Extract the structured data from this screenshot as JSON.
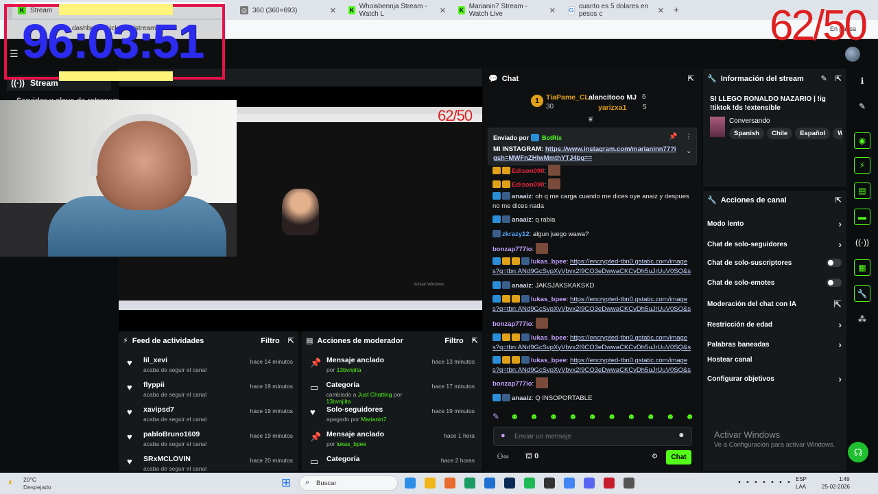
{
  "browser": {
    "tabs": [
      {
        "title": "Stream",
        "fav": "kick"
      },
      {
        "title": "360 (360×693)",
        "fav": "globe"
      },
      {
        "title": "Whoisbennja Stream - Watch L",
        "fav": "kick"
      },
      {
        "title": "Marianin7 Stream - Watch Live",
        "fav": "kick"
      },
      {
        "title": "cuanto es 5 dolares en pesos c",
        "fav": "google"
      }
    ],
    "new_tab": "+",
    "url": "dashboard.kick.com/stream",
    "profile_status": "En pausa"
  },
  "overlay": {
    "timer": "96:03:51",
    "counter": "62/50"
  },
  "nav": {
    "stream_label": "Stream",
    "sub_label": "Servidor y clave de retransm"
  },
  "preview": {
    "title": "Servidor y clave de retransm",
    "mini_counter": "62/50",
    "activate": "Activar Windows"
  },
  "feed": {
    "title": "Feed de actividades",
    "filter": "Filtro",
    "items": [
      {
        "name": "lil_xevi",
        "sub": "acaba de seguir el canal",
        "time": "hace 14 minutos"
      },
      {
        "name": "flyppii",
        "sub": "acaba de seguir el canal",
        "time": "hace 19 minutos"
      },
      {
        "name": "xavipsd7",
        "sub": "acaba de seguir el canal",
        "time": "hace 19 minutos"
      },
      {
        "name": "pabloBruno1609",
        "sub": "acaba de seguir el canal",
        "time": "hace 19 minutos"
      },
      {
        "name": "SRxMCLOVIN",
        "sub": "acaba de seguir el canal",
        "time": "hace 20 minutos"
      }
    ]
  },
  "modactions": {
    "title": "Acciones de moderador",
    "filter": "Filtro",
    "items": [
      {
        "name": "Mensaje anclado",
        "pre": "por ",
        "who": "13bvnjiita",
        "mid": "",
        "target": "",
        "time": "hace 13 minutos"
      },
      {
        "name": "Categoría",
        "pre": "cambiado a ",
        "who": "Just Chatting",
        "mid": " por ",
        "target": "13bvnjiita",
        "time": "hace 17 minutos"
      },
      {
        "name": "Solo-seguidores",
        "pre": "apagado por ",
        "who": "Marianin7",
        "mid": "",
        "target": "",
        "time": "hace 19 minutos"
      },
      {
        "name": "Mensaje anclado",
        "pre": "por ",
        "who": "lukas_bpee",
        "mid": "",
        "target": "",
        "time": "hace 1 hora"
      },
      {
        "name": "Categoría",
        "pre": "",
        "who": "",
        "mid": "",
        "target": "",
        "time": "hace 2 horas"
      }
    ]
  },
  "chat": {
    "title": "Chat",
    "leader1": {
      "rank": "1",
      "name": "TiaPame_CL",
      "count": "30"
    },
    "leader2": {
      "name": "alancitooo MJ",
      "count": "6"
    },
    "leader3": {
      "name": "yarizxa1",
      "count": "5"
    },
    "pinned": {
      "label": "Enviado por",
      "by": "BotRix",
      "text": "MI INSTAGRAM: ",
      "link": "https://www.instagram.com/marianinn77?igsh=MWFnZHlwMmthYTJ4bg=="
    },
    "messages": [
      {
        "user": "Edison090",
        "text": "",
        "color": "#e0243a"
      },
      {
        "user": "Edison090",
        "text": "",
        "color": "#e0243a"
      },
      {
        "user": "anaaiz",
        "text": "oh q me carga cuando me dices oye anaiz y despues no me dices nada",
        "color": "#d6d6e6"
      },
      {
        "user": "anaaiz",
        "text": "q rabia",
        "color": "#d6d6e6"
      },
      {
        "user": "zkrazy12",
        "text": "algun juego wawa?",
        "color": "#5aa9ff"
      },
      {
        "user": "bonzap777io",
        "text": "",
        "color": "#c6a3ff"
      },
      {
        "user": "lukas_bpee",
        "text": "https://encrypted-tbn0.gstatic.com/images?q=tbn:ANd9GcSvpXyVbvx2I9CO3eDwwaCKCvDh5uJrUuV0SQ&s",
        "color": "#c6a3ff"
      },
      {
        "user": "anaaiz",
        "text": "JAKSJAKSKAKSKD",
        "color": "#d6d6e6"
      },
      {
        "user": "lukas_bpee",
        "text": "https://encrypted-tbn0.gstatic.com/images?q=tbn:ANd9GcSvpXyVbvx2I9CO3eDwwaCKCvDh5uJrUuV0SQ&s",
        "color": "#c6a3ff"
      },
      {
        "user": "bonzap777io",
        "text": "",
        "color": "#c6a3ff"
      },
      {
        "user": "lukas_bpee",
        "text": "https://encrypted-tbn0.gstatic.com/images?q=tbn:ANd9GcSvpXyVbvx2I9CO3eDwwaCKCvDh5uJrUuV0SQ&s",
        "color": "#c6a3ff"
      },
      {
        "user": "lukas_bpee",
        "text": "https://encrypted-tbn0.gstatic.com/images?q=tbn:ANd9GcSvpXyVbvx2I9CO3eDwwaCKCvDh5uJrUuV0SQ&s",
        "color": "#c6a3ff"
      },
      {
        "user": "bonzap777io",
        "text": "",
        "color": "#c6a3ff"
      },
      {
        "user": "anaaiz",
        "text": "Q INSOPORTABLE",
        "color": "#d6d6e6"
      }
    ],
    "input_placeholder": "Enviar un mensaje",
    "points": "0",
    "send_label": "Chat"
  },
  "info": {
    "title": "Información del stream",
    "stream_title": "SI LLEGO RONALDO NAZARIO | !ig !tiktok !ds !extensible",
    "category": "Conversando",
    "tags": [
      "Spanish",
      "Chile",
      "Español",
      "Wa"
    ]
  },
  "actions": {
    "title": "Acciones de canal",
    "items": [
      {
        "label": "Modo lento",
        "kind": "chevron"
      },
      {
        "label": "Chat de solo-seguidores",
        "kind": "chevron"
      },
      {
        "label": "Chat de solo-suscriptores",
        "kind": "toggle"
      },
      {
        "label": "Chat de solo-emotes",
        "kind": "toggle"
      },
      {
        "label": "Moderación del chat con IA",
        "kind": "external"
      },
      {
        "label": "Restricción de edad",
        "kind": "chevron"
      },
      {
        "label": "Palabras baneadas",
        "kind": "chevron"
      },
      {
        "label": "Hostear canal",
        "kind": "none"
      },
      {
        "label": "Configurar objetivos",
        "kind": "chevron"
      }
    ],
    "activate_title": "Activar Windows",
    "activate_sub": "Ve a Configuración para activar Windows."
  },
  "taskbar": {
    "weather_temp": "20°C",
    "weather_desc": "Despejado",
    "search": "Buscar",
    "lang": "ESP",
    "lang_sub": "LAA",
    "time": "1:49",
    "date": "25-02-2026"
  },
  "colors": {
    "accent": "#53fc18",
    "overlay_border": "#e8124a",
    "timer_text": "#2c2cf0",
    "counter_text": "#e02020"
  }
}
